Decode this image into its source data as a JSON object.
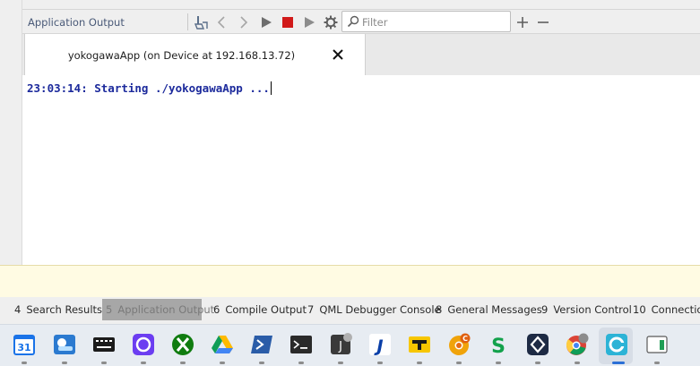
{
  "toolbar": {
    "title": "Application Output",
    "filter_placeholder": "Filter",
    "buttons": [
      "clean-icon",
      "back-icon",
      "forward-icon",
      "run-icon",
      "stop-icon",
      "debug-run-icon",
      "settings-icon",
      "add-icon",
      "remove-icon"
    ]
  },
  "tab": {
    "label": "yokogawaApp (on Device at 192.168.13.72)"
  },
  "output": {
    "lines": [
      "23:03:14: Starting ./yokogawaApp ..."
    ]
  },
  "panes": [
    {
      "num": "4",
      "label": "Search Results",
      "active": false
    },
    {
      "num": "5",
      "label": "Application Output",
      "active": true
    },
    {
      "num": "6",
      "label": "Compile Output",
      "active": false
    },
    {
      "num": "7",
      "label": "QML Debugger Console",
      "active": false
    },
    {
      "num": "8",
      "label": "General Messages",
      "active": false
    },
    {
      "num": "9",
      "label": "Version Control",
      "active": false
    },
    {
      "num": "10",
      "label": "Connection L",
      "active": false
    }
  ],
  "taskbar": {
    "apps": [
      "calendar-app-icon",
      "weather-app-icon",
      "keyboard-app-icon",
      "phone-link-app-icon",
      "xbox-app-icon",
      "google-drive-app-icon",
      "powershell-app-icon",
      "terminal-app-icon",
      "java-app-icon",
      "jira-app-icon",
      "tool-app-icon",
      "chrome-canary-app-icon",
      "s-app-icon",
      "vpn-app-icon",
      "chrome-profile-app-icon",
      "qt-creator-app-icon",
      "sheet-app-icon"
    ],
    "calendar_day": "31",
    "java_letter": "J",
    "jira_letter": "J",
    "canary_badge": "C",
    "s_letter": "S"
  },
  "colors": {
    "output_text": "#1c2a9c",
    "stop_red": "#d11a1a",
    "info_bar": "#fffbe3"
  }
}
